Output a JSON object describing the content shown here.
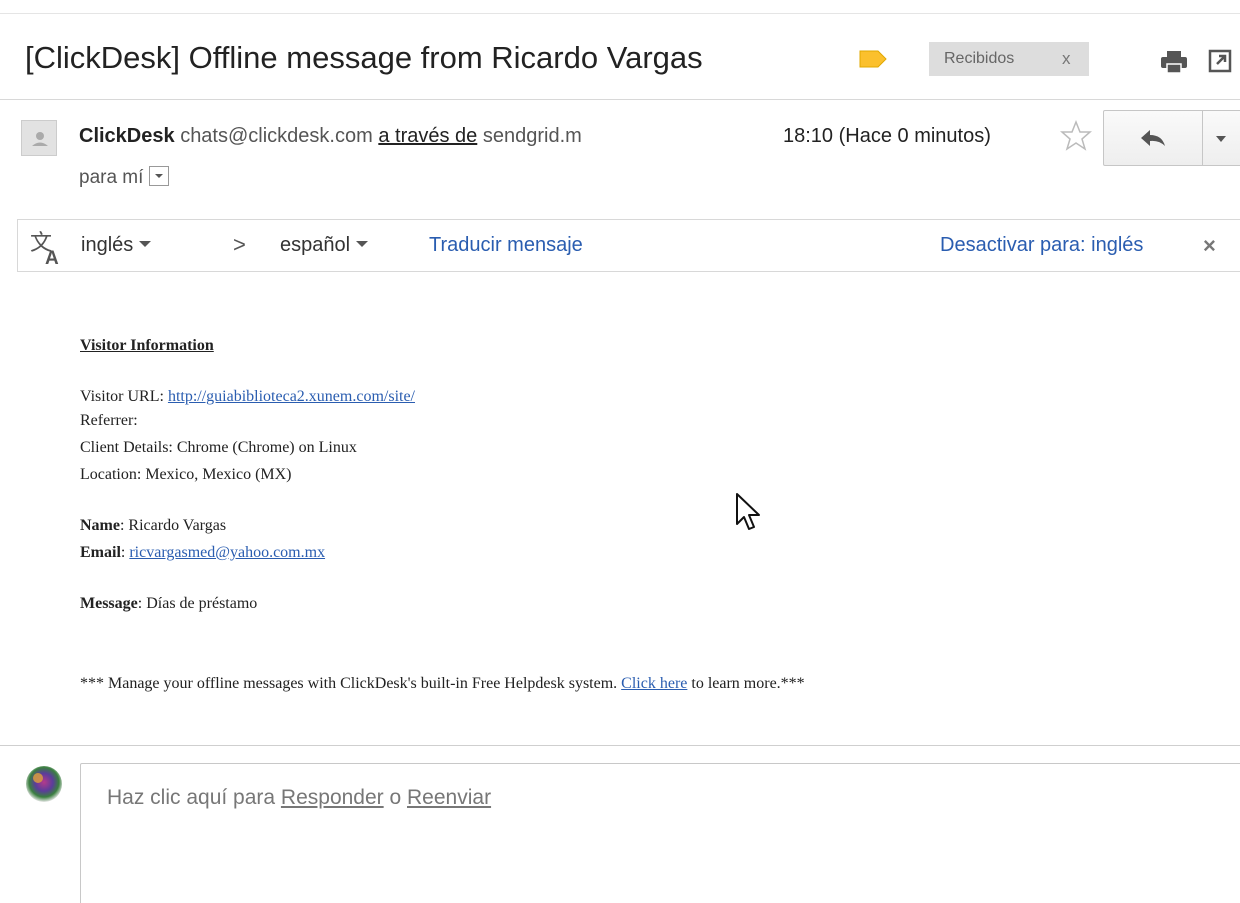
{
  "subject": {
    "title": "[ClickDesk] Offline message from Ricardo Vargas",
    "label_color": "#fbc02d",
    "label_chip": "Recibidos",
    "label_chip_close": "x",
    "icons": [
      "label-icon",
      "print-icon",
      "new-window-icon"
    ]
  },
  "header": {
    "sender_name": "ClickDesk",
    "sender_email": "chats@clickdesk.com",
    "via_label": "a través de",
    "via_domain": "sendgrid.m",
    "to_line": "para mí",
    "time": "18:10 (Hace 0 minutos)"
  },
  "translate": {
    "source_lang": "inglés",
    "arrow": ">",
    "target_lang": "español",
    "translate_link": "Traducir mensaje",
    "disable_link": "Desactivar para: inglés",
    "close": "×"
  },
  "message": {
    "section_title": "Visitor Information",
    "visitor_url_label": "Visitor URL: ",
    "visitor_url": "http://guiabiblioteca2.xunem.com/site/",
    "referrer": "Referrer:",
    "client_details": "Client Details: Chrome (Chrome) on Linux",
    "location": "Location: Mexico, Mexico (MX)",
    "name_label": "Name",
    "name_value": ": Ricardo Vargas",
    "email_label": "Email",
    "email_sep": ": ",
    "email_value": "ricvargasmed@yahoo.com.mx",
    "message_label": "Message",
    "message_value": ": Días de préstamo",
    "footer_pre": "*** Manage your offline messages with ClickDesk's built-in Free Helpdesk system. ",
    "footer_link": "Click here",
    "footer_post": " to learn more.***"
  },
  "reply": {
    "prompt_pre": "Haz clic aquí para ",
    "reply_link": "Responder",
    "prompt_mid": " o ",
    "forward_link": "Reenviar"
  }
}
